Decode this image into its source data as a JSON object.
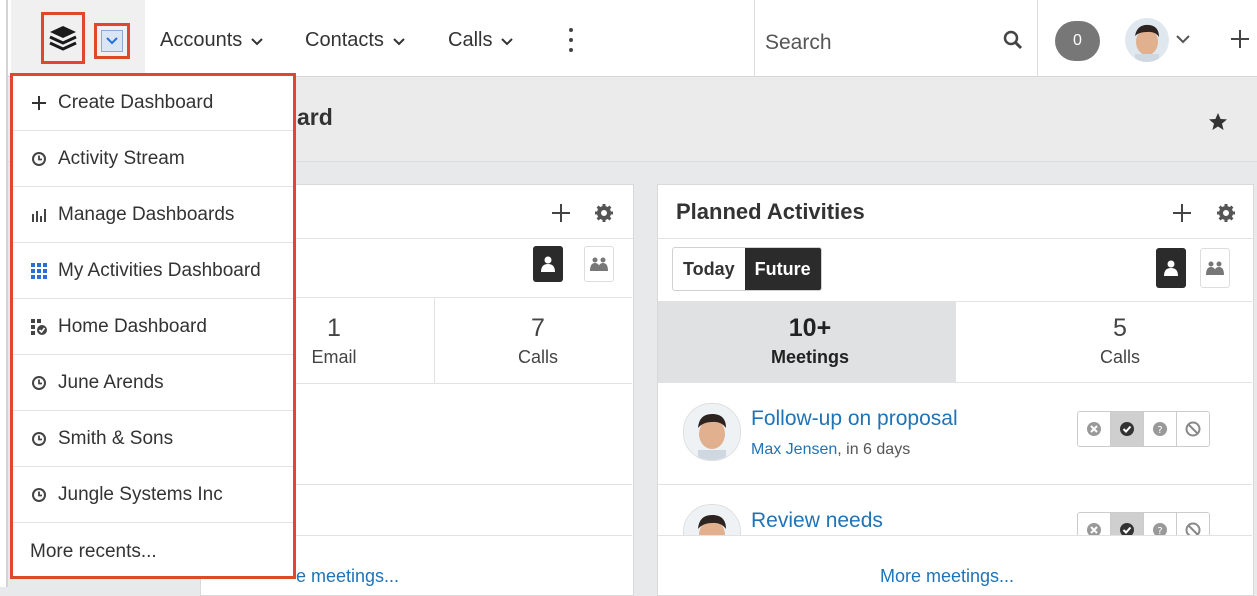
{
  "topnav": {
    "modules": [
      {
        "label": "Accounts"
      },
      {
        "label": "Contacts"
      },
      {
        "label": "Calls"
      }
    ],
    "search_placeholder": "Search",
    "notifications_count": "0",
    "icons": {
      "logo": "sugar-cube-icon",
      "search": "search-icon",
      "more": "kebab-icon",
      "add": "plus-icon"
    }
  },
  "page": {
    "title_fragment": "ard"
  },
  "dashlet_left": {
    "stats": [
      {
        "value": "1",
        "label": "Email"
      },
      {
        "value": "7",
        "label": "Calls"
      }
    ],
    "more_link": "e meetings..."
  },
  "planned_activities": {
    "title": "Planned Activities",
    "tabs": [
      {
        "label": "Today",
        "active": false
      },
      {
        "label": "Future",
        "active": true
      }
    ],
    "stats": [
      {
        "value": "10+",
        "label": "Meetings",
        "selected": true
      },
      {
        "value": "5",
        "label": "Calls",
        "selected": false
      }
    ],
    "items": [
      {
        "title": "Follow-up on proposal",
        "assignee": "Max Jensen",
        "when": ", in 6 days"
      },
      {
        "title": "Review needs",
        "assignee": "",
        "when": ""
      }
    ],
    "more_link": "More meetings..."
  },
  "dashboard_menu": {
    "items": [
      {
        "label": "Create Dashboard",
        "icon": "plus-icon"
      },
      {
        "label": "Activity Stream",
        "icon": "clock-icon"
      },
      {
        "label": "Manage Dashboards",
        "icon": "bar-chart-icon"
      },
      {
        "label": "My Activities Dashboard",
        "icon": "grid-icon"
      },
      {
        "label": "Home Dashboard",
        "icon": "home-dashboard-icon"
      },
      {
        "label": "June Arends",
        "icon": "clock-icon"
      },
      {
        "label": "Smith & Sons",
        "icon": "clock-icon"
      },
      {
        "label": "Jungle Systems Inc",
        "icon": "clock-icon"
      },
      {
        "label": "More recents...",
        "icon": ""
      }
    ]
  },
  "colors": {
    "highlight": "#e0482d",
    "link": "#1f73b7",
    "dark": "#2b2b2b",
    "grid_icon": "#2a6fd6"
  }
}
